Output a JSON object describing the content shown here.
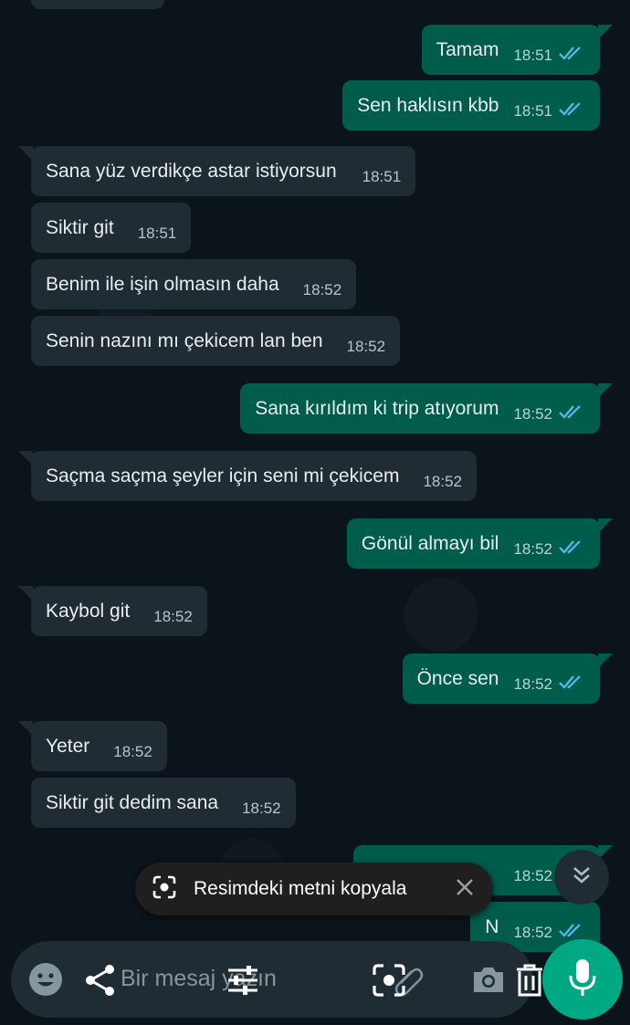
{
  "colors": {
    "background": "#0b141a",
    "incoming_bubble": "#202c33",
    "outgoing_bubble": "#005c4b",
    "read_ticks": "#53bdeb",
    "mic_button": "#00a884"
  },
  "messages": [
    {
      "dir": "out",
      "text": "Tamam",
      "time": "18:51"
    },
    {
      "dir": "out",
      "text": "Sen haklısın kbb",
      "time": "18:51"
    },
    {
      "dir": "in",
      "text": "Sana yüz verdikçe astar istiyorsun",
      "time": "18:51"
    },
    {
      "dir": "in",
      "text": "Siktir git",
      "time": "18:51"
    },
    {
      "dir": "in",
      "text": "Benim ile işin olmasın daha",
      "time": "18:52"
    },
    {
      "dir": "in",
      "text": "Senin nazını mı çekicem lan ben",
      "time": "18:52"
    },
    {
      "dir": "out",
      "text": "Sana kırıldım ki trip atıyorum",
      "time": "18:52"
    },
    {
      "dir": "in",
      "text": "Saçma saçma şeyler için seni mi çekicem",
      "time": "18:52"
    },
    {
      "dir": "out",
      "text": "Gönül almayı bil",
      "time": "18:52"
    },
    {
      "dir": "in",
      "text": "Kaybol git",
      "time": "18:52"
    },
    {
      "dir": "out",
      "text": "Önce sen",
      "time": "18:52"
    },
    {
      "dir": "in",
      "text": "Yeter",
      "time": "18:52"
    },
    {
      "dir": "in",
      "text": "Siktir git dedim sana",
      "time": "18:52"
    },
    {
      "dir": "out",
      "text": "",
      "time": "18:52"
    },
    {
      "dir": "out",
      "text": "N",
      "time": "18:52"
    }
  ],
  "toast": {
    "label": "Resimdeki metni kopyala"
  },
  "input": {
    "placeholder": "Bir mesaj yazın"
  },
  "icons": {
    "emoji": "emoji-icon",
    "share": "share-icon",
    "adjust": "sliders-icon",
    "lens": "lens-icon",
    "attach": "paperclip-icon",
    "camera": "camera-icon",
    "delete": "trash-icon",
    "mic": "mic-icon",
    "scroll": "chevron-double-down-icon"
  }
}
